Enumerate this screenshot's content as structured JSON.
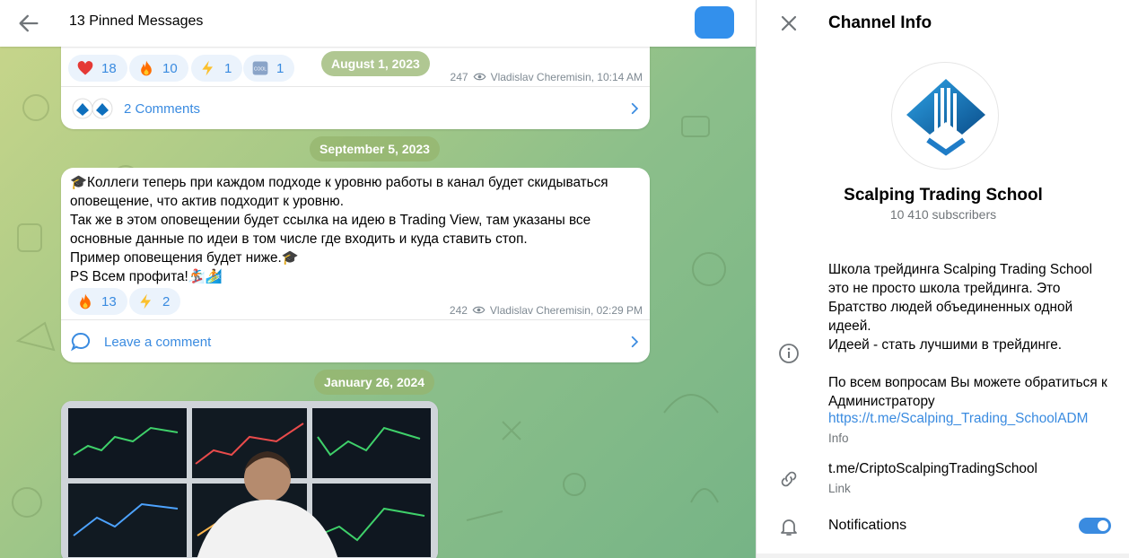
{
  "header": {
    "title": "13 Pinned Messages"
  },
  "messages": [
    {
      "date": "August 1, 2023",
      "reactions": [
        {
          "icon": "heart-icon",
          "emoji": "❤️",
          "count": "18"
        },
        {
          "icon": "fire-icon",
          "emoji": "🔥",
          "count": "10"
        },
        {
          "icon": "lightning-icon",
          "emoji": "⚡",
          "count": "1"
        },
        {
          "icon": "cool-icon",
          "emoji": "🆒",
          "count": "1"
        }
      ],
      "views": "247",
      "author_time": "Vladislav Cheremisin, 10:14 AM",
      "comments_label": "2 Comments"
    },
    {
      "date": "September 5, 2023",
      "text": "🎓Коллеги теперь при каждом подходе к уровню работы в канал будет скидываться оповещение, что актив подходит к уровню.\nТак же в этом оповещении будет ссылка на идею в Trading View, там указаны все основные данные по идеи в том числе где входить и куда ставить стоп.\nПример оповещения будет ниже.🎓\nPS Всем профита!🏂🏄",
      "reactions": [
        {
          "icon": "fire-icon",
          "emoji": "🔥",
          "count": "13"
        },
        {
          "icon": "lightning-icon",
          "emoji": "⚡",
          "count": "2"
        }
      ],
      "views": "242",
      "author_time": "Vladislav Cheremisin, 02:29 PM",
      "comments_label": "Leave a comment"
    },
    {
      "date": "January 26, 2024"
    }
  ],
  "panel": {
    "title": "Channel Info",
    "channel_name": "Scalping Trading School",
    "subscribers": "10 410 subscribers",
    "description": "Школа трейдинга Scalping Trading School это не просто школа трейдинга. Это Братство людей объединенных одной идеей.\nИдеей - стать лучшими в трейдинге.\n\nПо всем вопросам Вы можете обратиться к Администратору",
    "info_link": "https://t.me/Scalping_Trading_SchoolADM",
    "info_label": "Info",
    "link": "t.me/CriptoScalpingTradingSchool",
    "link_label": "Link",
    "notifications_label": "Notifications",
    "notifications_on": true
  },
  "colors": {
    "accent": "#3a8be0",
    "header_button": "#3390ec",
    "logo_blue": "#0e6fbd"
  }
}
